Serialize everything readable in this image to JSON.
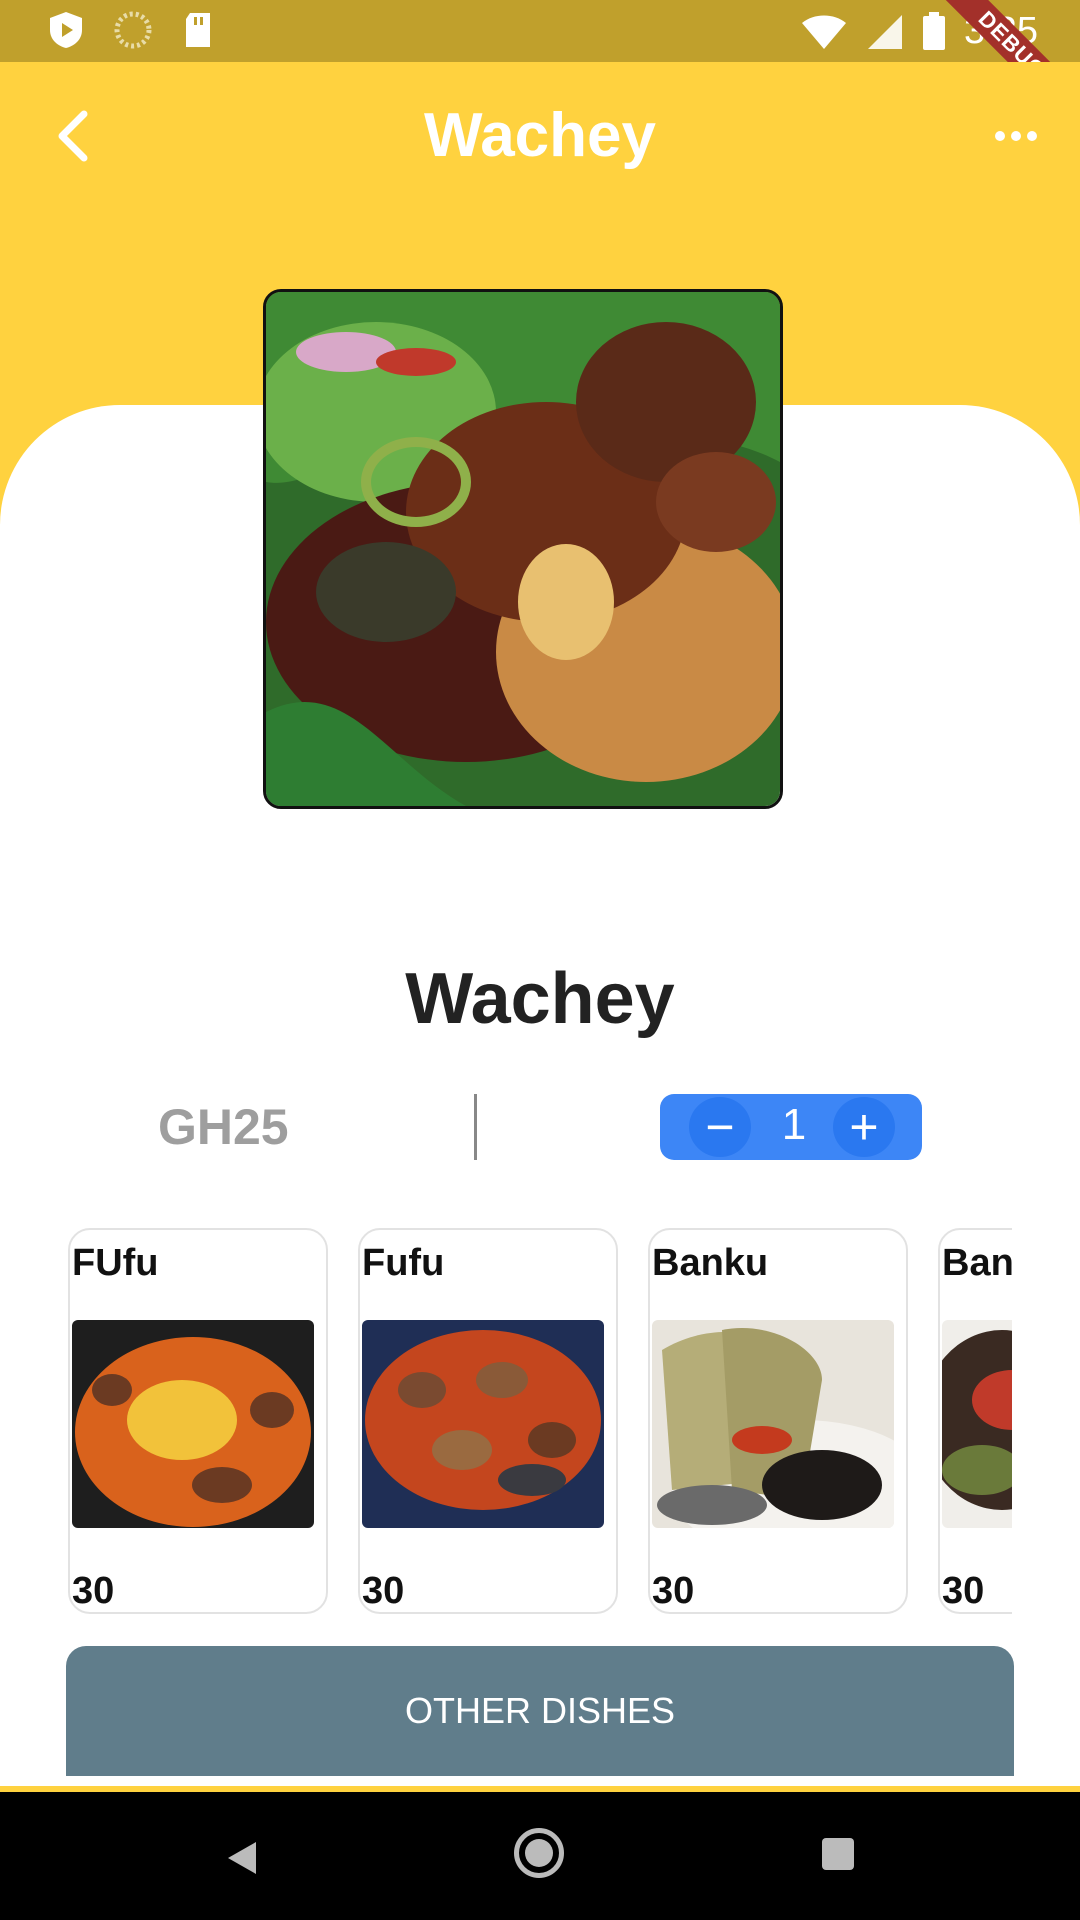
{
  "status_bar": {
    "time": "3:25",
    "debug_label": "DEBUG"
  },
  "app_bar": {
    "title": "Wachey"
  },
  "dish": {
    "name": "Wachey",
    "price": "GH25",
    "quantity": "1"
  },
  "stepper": {
    "minus": "−",
    "plus": "+"
  },
  "related_dishes": [
    {
      "name": "FUfu",
      "price": "30"
    },
    {
      "name": "Fufu",
      "price": "30"
    },
    {
      "name": "Banku",
      "price": "30"
    },
    {
      "name": "Banl",
      "price": "30"
    }
  ],
  "other_dishes_button": "OTHER DISHES",
  "colors": {
    "primary": "#ffd23f",
    "status": "#c0a02c",
    "stepper": "#3d86f6",
    "button": "#607d8b"
  }
}
